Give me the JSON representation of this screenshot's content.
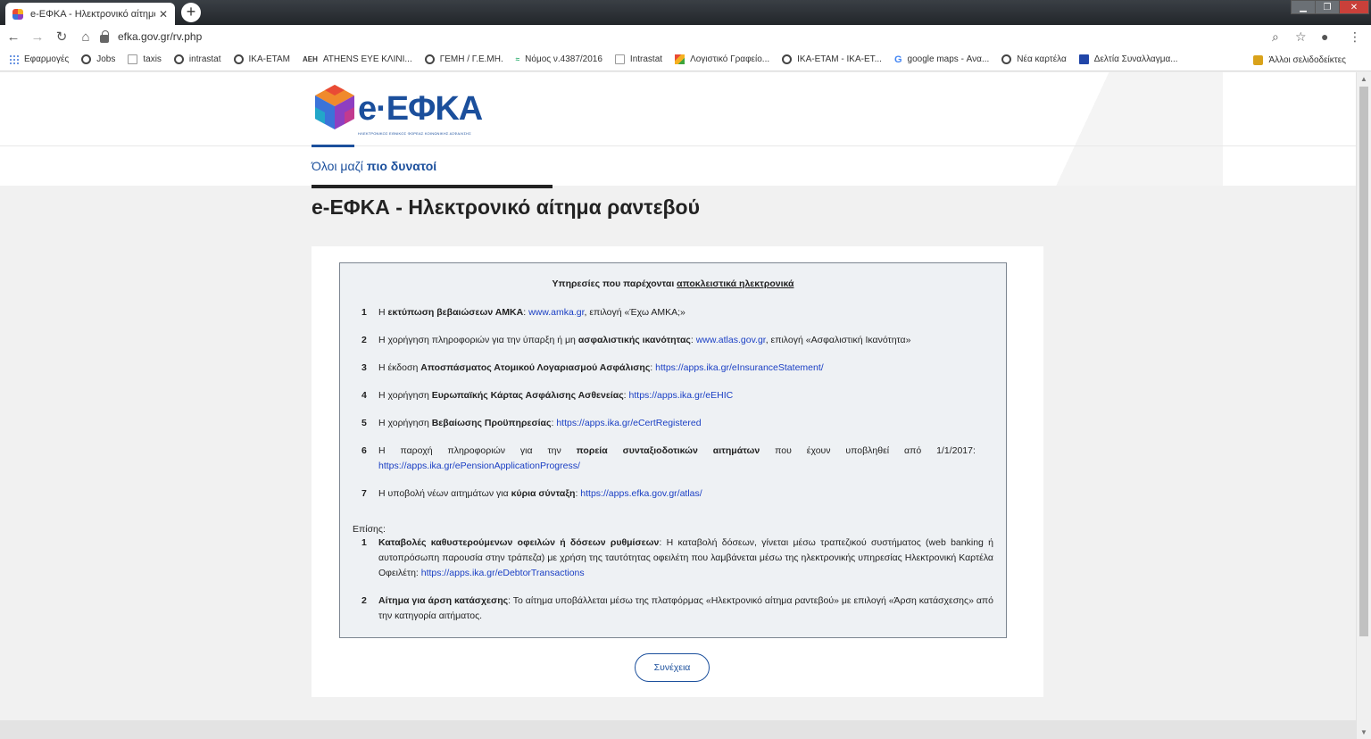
{
  "browser": {
    "tab_title": "e-ΕΦΚΑ - Ηλεκτρονικό αίτημα ρ",
    "tab_close": "✕",
    "new_tab": "+",
    "url": "efka.gov.gr/rv.php",
    "bookmarks": [
      {
        "label": "Εφαρμογές",
        "icon": "apps-grid-icon"
      },
      {
        "label": "Jobs",
        "icon": "globe-icon"
      },
      {
        "label": "taxis",
        "icon": "taxis-icon"
      },
      {
        "label": "intrastat",
        "icon": "globe-icon"
      },
      {
        "label": "ΙΚΑ-ΕΤΑΜ",
        "icon": "globe-icon"
      },
      {
        "label": "ATHENS EYE ΚΛΙΝΙ...",
        "icon": "aeh-logo-icon"
      },
      {
        "label": "ΓΕΜΗ / Γ.Ε.ΜΗ.",
        "icon": "globe-icon"
      },
      {
        "label": "Νόμος ν.4387/2016",
        "icon": "law-icon"
      },
      {
        "label": "Intrastat",
        "icon": "document-icon"
      },
      {
        "label": "Λογιστικό Γραφείο...",
        "icon": "joomla-icon"
      },
      {
        "label": "ΙΚΑ-ΕΤΑΜ - ΙΚΑ-ΕΤ...",
        "icon": "globe-icon"
      },
      {
        "label": "google maps - Ανα...",
        "icon": "google-icon"
      },
      {
        "label": "Νέα καρτέλα",
        "icon": "globe-icon"
      },
      {
        "label": "Δελτία Συναλλαγμα...",
        "icon": "bank-icon"
      }
    ],
    "other_bookmarks": "Άλλοι σελιδοδείκτες"
  },
  "header": {
    "logo_text": "e·ΕΦΚΑ",
    "logo_subtitle": "ΗΛΕΚΤΡΟΝΙΚΟΣ ΕΘΝΙΚΟΣ ΦΟΡΕΑΣ ΚΟΙΝΩΝΙΚΗΣ ΑΣΦΑΛΙΣΗΣ",
    "tagline_normal": "Όλοι μαζί ",
    "tagline_bold": "πιο δυνατοί"
  },
  "page_title": "e-ΕΦΚΑ - Ηλεκτρονικό αίτημα ραντεβού",
  "box": {
    "heading_prefix": "Υπηρεσίες που παρέχονται ",
    "heading_underlined": "αποκλειστικά ηλεκτρονικά",
    "services": [
      {
        "num": "1",
        "pre": "Η ",
        "bold": "εκτύπωση βεβαιώσεων ΑΜΚΑ",
        "mid": ": ",
        "link": "www.amka.gr",
        "post": ", επιλογή «Έχω ΑΜΚΑ;»"
      },
      {
        "num": "2",
        "pre": "Η χορήγηση πληροφοριών για την ύπαρξη ή μη ",
        "bold": "ασφαλιστικής ικανότητας",
        "mid": ": ",
        "link": "www.atlas.gov.gr",
        "post": ", επιλογή «Ασφαλιστική Ικανότητα»"
      },
      {
        "num": "3",
        "pre": "Η έκδοση ",
        "bold": "Αποσπάσματος Ατομικού Λογαριασμού Ασφάλισης",
        "mid": ": ",
        "link": "https://apps.ika.gr/eInsuranceStatement/",
        "post": ""
      },
      {
        "num": "4",
        "pre": "Η χορήγηση ",
        "bold": "Ευρωπαϊκής Κάρτας Ασφάλισης Ασθενείας",
        "mid": ": ",
        "link": "https://apps.ika.gr/eEHIC",
        "post": ""
      },
      {
        "num": "5",
        "pre": "Η χορήγηση ",
        "bold": "Βεβαίωσης Προϋπηρεσίας",
        "mid": ": ",
        "link": "https://apps.ika.gr/eCertRegistered",
        "post": ""
      },
      {
        "num": "6",
        "pre": "Η παροχή πληροφοριών για την ",
        "bold": "πορεία συνταξιοδοτικών αιτημάτων",
        "mid": " που έχουν υποβληθεί από 1/1/2017: ",
        "link": "https://apps.ika.gr/ePensionApplicationProgress/",
        "post": ""
      },
      {
        "num": "7",
        "pre": "Η υποβολή νέων αιτημάτων για ",
        "bold": "κύρια σύνταξη",
        "mid": ": ",
        "link": "https://apps.efka.gov.gr/atlas/",
        "post": ""
      }
    ],
    "also_label": "Επίσης:",
    "also_items": [
      {
        "num": "1",
        "bold": "Καταβολές καθυστερούμενων οφειλών ή δόσεων ρυθμίσεων",
        "text": ": Η καταβολή δόσεων, γίνεται μέσω τραπεζικού συστήματος (web banking ή αυτοπρόσωπη παρουσία στην τράπεζα) με χρήση της ταυτότητας οφειλέτη που λαμβάνεται μέσω της ηλεκτρονικής υπηρεσίας Ηλεκτρονική Καρτέλα Οφειλέτη: ",
        "link": "https://apps.ika.gr/eDebtorTransactions"
      },
      {
        "num": "2",
        "bold": "Αίτημα για άρση κατάσχεσης",
        "text": ": Το αίτημα υποβάλλεται μέσω της πλατφόρμας «Ηλεκτρονικό αίτημα ραντεβού» με επιλογή «Άρση κατάσχεσης» από την κατηγορία αιτήματος.",
        "link": ""
      }
    ]
  },
  "continue_button": "Συνέχεια",
  "colors": {
    "brand": "#1b4f9c",
    "link": "#1a3fc4",
    "box_bg": "#eef1f4"
  }
}
